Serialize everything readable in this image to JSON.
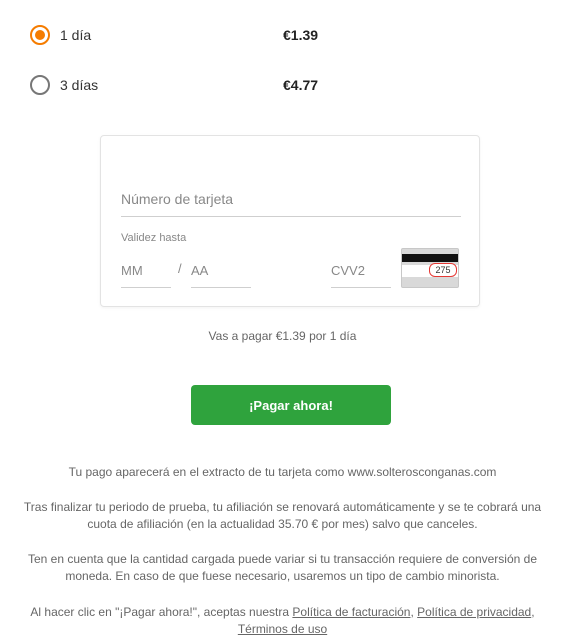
{
  "plans": [
    {
      "label": "1 día",
      "price": "€1.39",
      "selected": true
    },
    {
      "label": "3 días",
      "price": "€4.77",
      "selected": false
    }
  ],
  "card_form": {
    "card_number_placeholder": "Número de tarjeta",
    "expiry_label": "Validez hasta",
    "month_placeholder": "MM",
    "separator": "/",
    "year_placeholder": "AA",
    "cvv_placeholder": "CVV2",
    "cvv_example": "275"
  },
  "summary_text": "Vas a pagar €1.39 por 1 día",
  "pay_button_label": "¡Pagar ahora!",
  "notes": {
    "statement": "Tu pago aparecerá en el extracto de tu tarjeta como www.solterosconganas.com",
    "renewal": "Tras finalizar tu periodo de prueba, tu afiliación se renovará automáticamente y se te cobrará una cuota de afiliación (en la actualidad 35.70 € por mes) salvo que canceles.",
    "conversion": "Ten en cuenta que la cantidad cargada puede variar si tu transacción requiere de conversión de moneda. En caso de que fuese necesario, usaremos un tipo de cambio minorista.",
    "terms_prefix": "Al hacer clic en \"¡Pagar ahora!\", aceptas nuestra ",
    "billing_policy": "Política de facturación",
    "sep": ", ",
    "privacy_policy": "Política de privacidad",
    "sep2": ",",
    "terms_of_use": "Términos de uso"
  },
  "colors": {
    "accent": "#f57c00",
    "pay_button": "#2fa33d",
    "cvv_highlight": "#e53935"
  }
}
